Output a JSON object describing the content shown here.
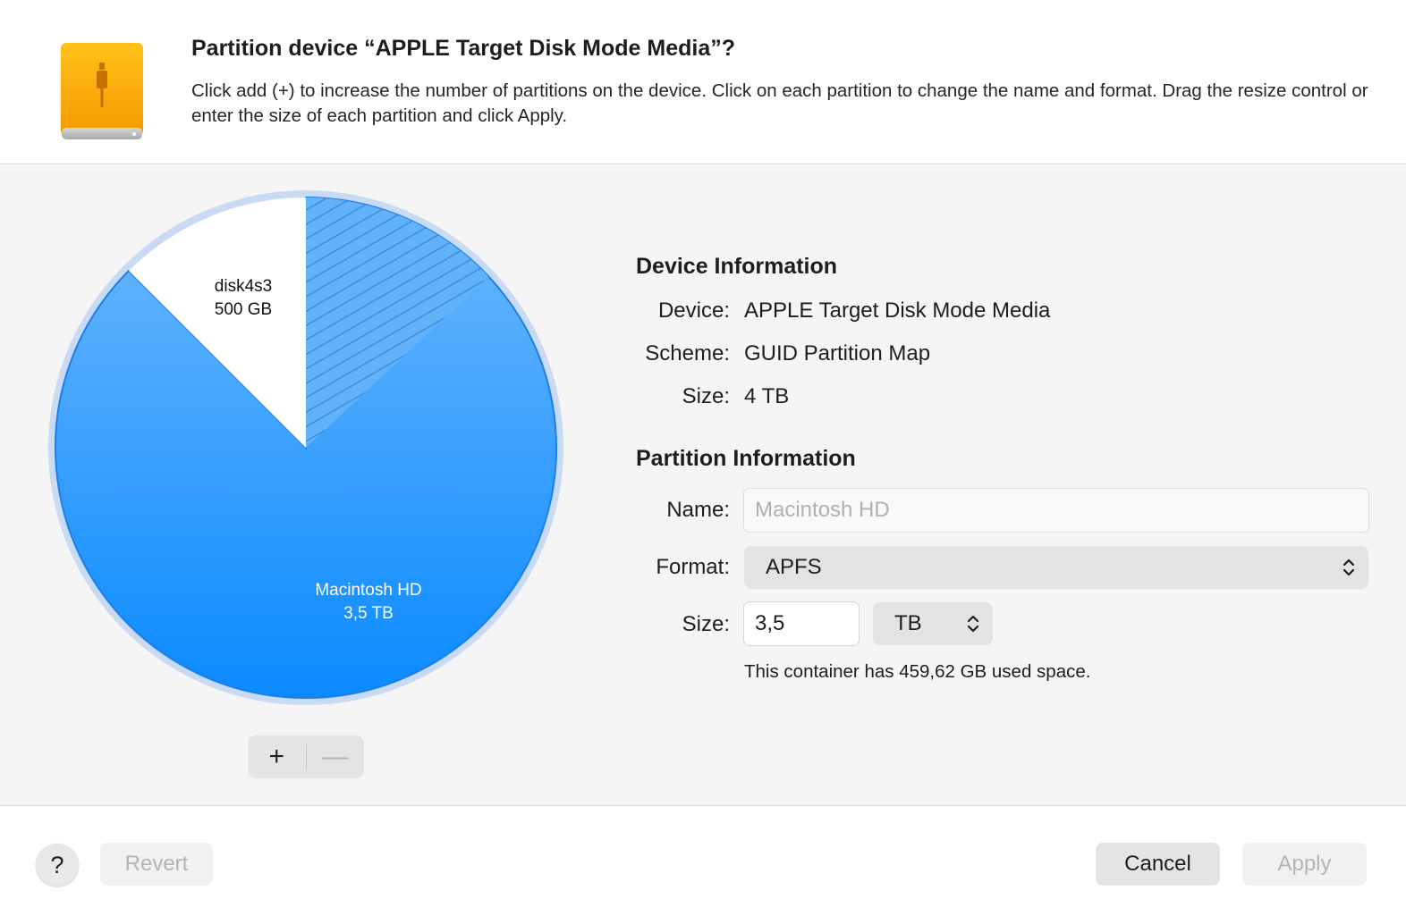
{
  "dialog": {
    "title": "Partition device “APPLE Target Disk Mode Media”?",
    "description": "Click add (+) to increase the number of partitions on the device. Click on each partition to change the name and format. Drag the resize control or enter the size of each partition and click Apply.",
    "icon": "external-drive-icon"
  },
  "pie": {
    "partitions": [
      {
        "name": "Macintosh HD",
        "size": "3,5 TB",
        "fraction": 0.875,
        "color": "#2f97f9",
        "selected": true
      },
      {
        "name": "disk4s3",
        "size": "500 GB",
        "fraction": 0.125,
        "color": "#ffffff"
      }
    ],
    "used_fraction_of_selected": 0.13,
    "add_label": "+",
    "remove_label": "—"
  },
  "device_info": {
    "heading": "Device Information",
    "device_label": "Device:",
    "device_value": "APPLE Target Disk Mode Media",
    "scheme_label": "Scheme:",
    "scheme_value": "GUID Partition Map",
    "size_label": "Size:",
    "size_value": "4 TB"
  },
  "partition_info": {
    "heading": "Partition Information",
    "name_label": "Name:",
    "name_placeholder": "Macintosh HD",
    "format_label": "Format:",
    "format_value": "APFS",
    "size_label": "Size:",
    "size_value": "3,5",
    "unit_value": "TB",
    "used_note": "This container has 459,62 GB used space."
  },
  "footer": {
    "help_label": "?",
    "revert_label": "Revert",
    "cancel_label": "Cancel",
    "apply_label": "Apply"
  },
  "colors": {
    "accent": "#2f97f9",
    "drive": "#f7a600"
  }
}
